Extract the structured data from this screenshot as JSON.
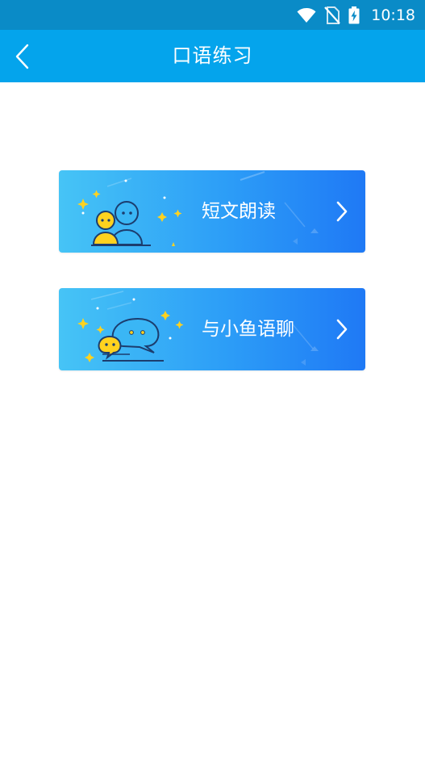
{
  "status_bar": {
    "time": "10:18",
    "icons": [
      "wifi-icon",
      "no-sim-icon",
      "battery-charging-icon"
    ]
  },
  "header": {
    "title": "口语练习",
    "back_icon": "back-chevron-icon"
  },
  "cards": [
    {
      "label": "短文朗读",
      "illustration": "two-people-icon",
      "arrow": "chevron-right-icon"
    },
    {
      "label": "与小鱼语聊",
      "illustration": "chat-bubbles-icon",
      "arrow": "chevron-right-icon"
    }
  ],
  "colors": {
    "status_bar": "#0a8bc7",
    "app_bar": "#04a4ec",
    "card_gradient_start": "#46c4f6",
    "card_gradient_end": "#1f79f5",
    "accent_yellow": "#ffd21f",
    "background": "#ffffff"
  }
}
